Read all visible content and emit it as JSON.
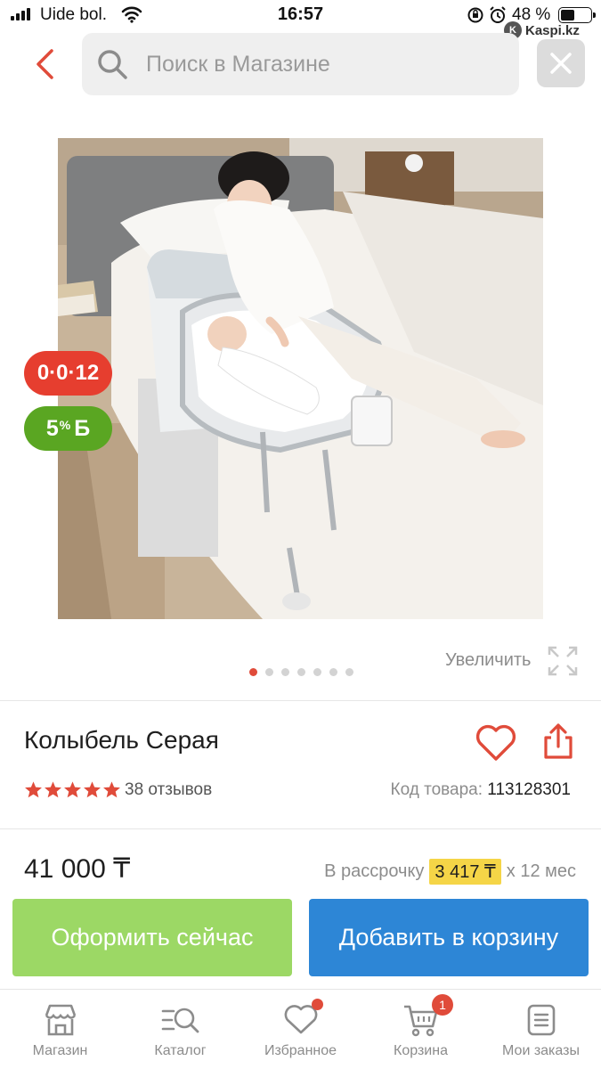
{
  "status_bar": {
    "carrier": "Uide bol.",
    "time": "16:57",
    "battery_percent": "48 %",
    "battery_level": 0.48
  },
  "watermark": {
    "text": "Kaspi.kz"
  },
  "header": {
    "search_placeholder": "Поиск в Магазине"
  },
  "gallery": {
    "badges": {
      "installment": "0·0·12",
      "bonus_value": "5",
      "bonus_unit": "%",
      "bonus_currency": "Б"
    },
    "zoom_label": "Увеличить",
    "image_count": 7,
    "active_image": 1
  },
  "product": {
    "title": "Колыбель Серая",
    "rating": 5,
    "reviews": "38 отзывов",
    "sku_label": "Код товара:",
    "sku_value": "113128301"
  },
  "pricing": {
    "price": "41 000 ₸",
    "installment_prefix": "В рассрочку",
    "installment_monthly": "3 417 ₸",
    "installment_suffix": "х 12 мес"
  },
  "actions": {
    "buy_now": "Оформить сейчас",
    "add_to_cart": "Добавить в корзину"
  },
  "tab_bar": {
    "items": [
      {
        "label": "Магазин",
        "icon": "shop-icon"
      },
      {
        "label": "Каталог",
        "icon": "catalog-search-icon"
      },
      {
        "label": "Избранное",
        "icon": "heart-icon"
      },
      {
        "label": "Корзина",
        "icon": "cart-icon",
        "badge": "1"
      },
      {
        "label": "Мои заказы",
        "icon": "orders-icon"
      }
    ]
  },
  "colors": {
    "accent_red": "#e04b3a",
    "buy_green": "#9cd865",
    "cart_blue": "#2d86d6",
    "installment_highlight": "#f5d547",
    "bonus_green": "#5aa622"
  }
}
